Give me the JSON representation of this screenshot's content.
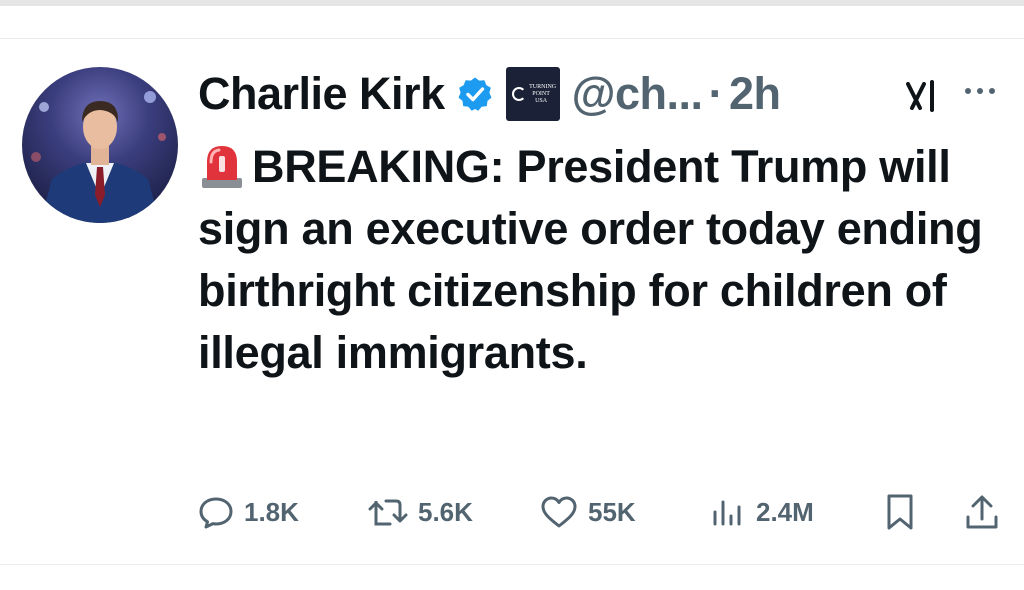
{
  "author": {
    "display_name": "Charlie Kirk",
    "verified": true,
    "affiliation_badge_text": "TURNING POINT USA",
    "handle": "@ch...",
    "separator": "·",
    "time": "2h"
  },
  "tweet": {
    "emoji": "siren-icon",
    "text": "BREAKING: President Trump will sign an executive order today ending birthright citizenship for children of illegal immigrants."
  },
  "actions": {
    "replies": "1.8K",
    "reposts": "5.6K",
    "likes": "55K",
    "views": "2.4M"
  },
  "icons": [
    "verified-badge-icon",
    "grok-icon",
    "more-icon",
    "reply-icon",
    "repost-icon",
    "like-icon",
    "views-icon",
    "bookmark-icon",
    "share-icon"
  ],
  "colors": {
    "verified_blue": "#1d9bf0",
    "text_primary": "#0f1419",
    "text_secondary": "#536471",
    "badge_navy": "#1b2237"
  }
}
